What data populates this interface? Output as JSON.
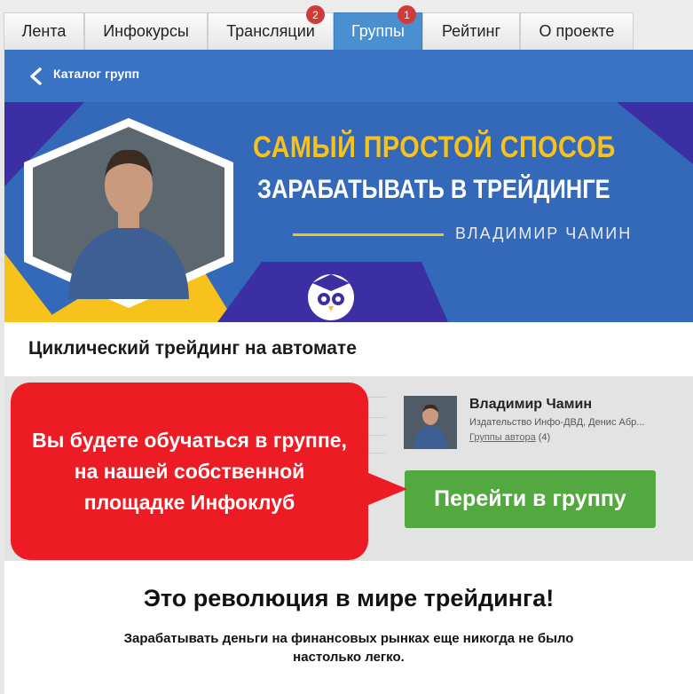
{
  "tabs": [
    {
      "label": "Лента",
      "badge": null
    },
    {
      "label": "Инфокурсы",
      "badge": null
    },
    {
      "label": "Трансляции",
      "badge": "2"
    },
    {
      "label": "Группы",
      "badge": "1",
      "active": true
    },
    {
      "label": "Рейтинг",
      "badge": null
    },
    {
      "label": "О проекте",
      "badge": null
    }
  ],
  "header": {
    "title": "Каталог групп",
    "back_icon": "chevron-left-icon"
  },
  "banner": {
    "line1": "САМЫЙ ПРОСТОЙ СПОСОБ",
    "line2": "ЗАРАБАТЫВАТЬ В ТРЕЙДИНГЕ",
    "author": "ВЛАДИМИР ЧАМИН",
    "logo_icon": "owl-graduate-icon"
  },
  "group": {
    "title": "Циклический трейдинг на автомате"
  },
  "author": {
    "name": "Владимир Чамин",
    "publisher": "Издательство Инфо-ДВД, Денис Абр...",
    "groups_link": "Группы автора",
    "groups_count": "(4)"
  },
  "cta": {
    "label": "Перейти в группу"
  },
  "callout": {
    "line1": "Вы будете обучаться в группе,",
    "line2": "на нашей собственной",
    "line3": "площадке Инфоклуб"
  },
  "content": {
    "heading": "Это революция в мире трейдинга!",
    "sub_line1": "Зарабатывать деньги на финансовых рынках еще никогда не было",
    "sub_line2": "настолько легко."
  },
  "colors": {
    "header_blue": "#3a73c4",
    "active_tab": "#4a8fcf",
    "banner_yellow": "#f7c21c",
    "banner_purple": "#3b2fa3",
    "cta_green": "#53a83f",
    "callout_red": "#ed1c24",
    "badge_red": "#cf3b3b"
  }
}
